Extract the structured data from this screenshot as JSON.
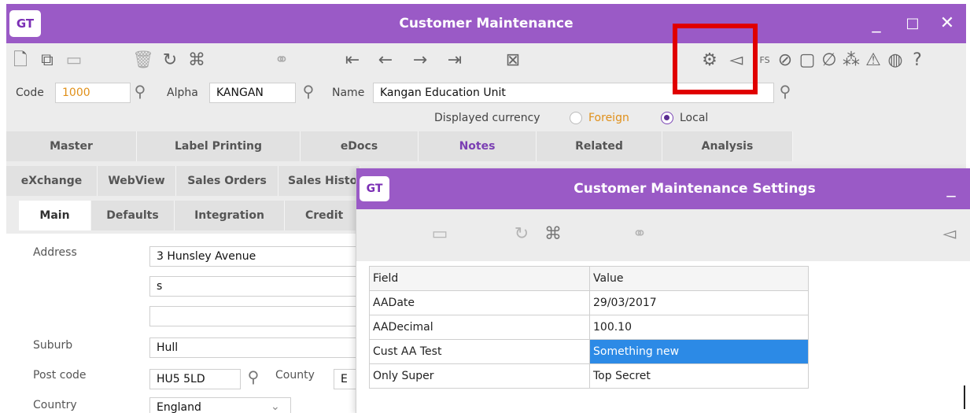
{
  "window": {
    "logo": "GT",
    "title": "Customer Maintenance",
    "minimize": "_",
    "maximize": "□",
    "close": "✕"
  },
  "toolbar": {
    "fs_label": "FS"
  },
  "code_row": {
    "code_label": "Code",
    "code_value": "1000",
    "alpha_label": "Alpha",
    "alpha_value": "KANGAN",
    "name_label": "Name",
    "name_value": "Kangan Education Unit"
  },
  "currency": {
    "label": "Displayed currency",
    "foreign": "Foreign",
    "local": "Local",
    "selected": "Local"
  },
  "tabs_row1": [
    "Master",
    "Label Printing",
    "eDocs",
    "Notes",
    "Related",
    "Analysis"
  ],
  "tabs_row2": [
    "eXchange",
    "WebView",
    "Sales Orders",
    "Sales Histo"
  ],
  "tabs_row3": [
    "Main",
    "Defaults",
    "Integration",
    "Credit"
  ],
  "form": {
    "address_label": "Address",
    "address_line1": "3 Hunsley Avenue",
    "address_line2": "s",
    "address_line3": "",
    "suburb_label": "Suburb",
    "suburb_value": "Hull",
    "postcode_label": "Post code",
    "postcode_value": "HU5 5LD",
    "county_label": "County",
    "county_value": "E",
    "country_label": "Country",
    "country_value": "England"
  },
  "dialog": {
    "logo": "GT",
    "title": "Customer Maintenance Settings",
    "minimize": "_",
    "grid_headers": [
      "Field",
      "Value"
    ],
    "rows": [
      {
        "field": "AADate",
        "value": "29/03/2017"
      },
      {
        "field": "AADecimal",
        "value": "100.10"
      },
      {
        "field": "Cust AA Test",
        "value": "Something new"
      },
      {
        "field": "Only Super",
        "value": "Top Secret"
      }
    ]
  },
  "colors": {
    "title_bar": "#9a5ac6",
    "highlight": "#e00000",
    "selected_cell": "#2c8ae6",
    "code_value": "#e0901a",
    "foreign_text": "#e0901a"
  }
}
